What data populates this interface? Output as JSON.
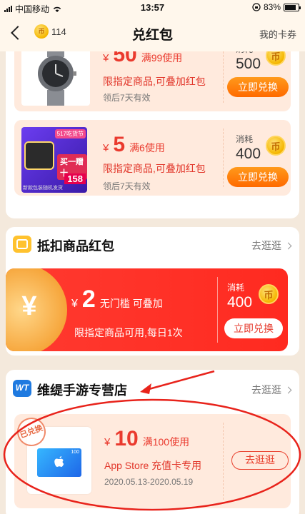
{
  "status_bar": {
    "carrier": "中国移动",
    "time": "13:57",
    "battery": "83%"
  },
  "header": {
    "coin_count": "114",
    "title": "兑红包",
    "my_coupons": "我的卡券"
  },
  "coupons_top": [
    {
      "amount": "50",
      "currency": "¥",
      "condition": "满99使用",
      "desc": "限指定商品,可叠加红包",
      "validity": "领后7天有效",
      "cost_label": "消耗",
      "cost": "500",
      "button": "立即兑换"
    },
    {
      "amount": "5",
      "currency": "¥",
      "condition": "满6使用",
      "desc": "限指定商品,可叠加红包",
      "validity": "领后7天有效",
      "cost_label": "消耗",
      "cost": "400",
      "button": "立即兑换",
      "thumb": {
        "badge": "517吃货节",
        "slogan": "买一赠十",
        "price": "158",
        "footer": "新款包装随机发货"
      }
    }
  ],
  "section_deduct": {
    "title": "抵扣商品红包",
    "link": "去逛逛",
    "coupon": {
      "yen_symbol": "¥",
      "currency": "¥",
      "amount": "2",
      "condition": "无门槛 可叠加",
      "desc": "限指定商品可用,每日1次",
      "cost_label": "消耗",
      "cost": "400",
      "button": "立即兑换"
    }
  },
  "section_store": {
    "logo_text": "WT",
    "title": "维缇手游专营店",
    "link": "去逛逛",
    "coupon": {
      "stamp": "已兑换",
      "card_value": "100",
      "currency": "¥",
      "amount": "10",
      "condition": "满100使用",
      "desc": "App Store 充值卡专用",
      "dates": "2020.05.13-2020.05.19",
      "button": "去逛逛"
    }
  },
  "coin_glyph": "币",
  "colors": {
    "accent_red": "#ea3a2e",
    "accent_orange": "#ff7a00",
    "background": "#f4e9dc"
  }
}
